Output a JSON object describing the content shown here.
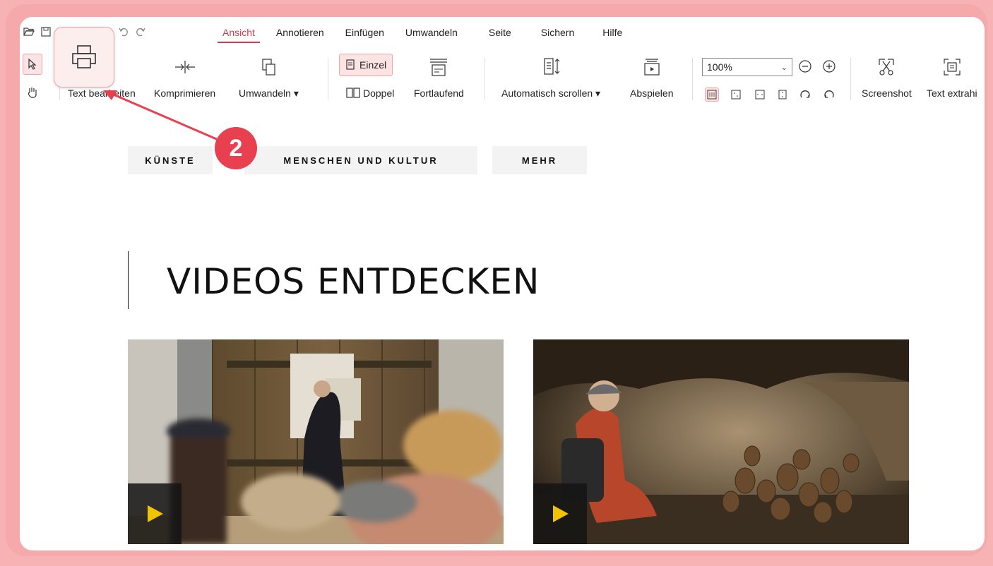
{
  "ribbon": {
    "tabs": [
      "Ansicht",
      "Annotieren",
      "Einfügen",
      "Umwandeln",
      "Seite",
      "Sichern",
      "Hilfe"
    ],
    "tools": {
      "edit_text": "Text bearbeiten",
      "compress": "Komprimieren",
      "convert": "Umwandeln ▾",
      "single": "Einzel",
      "double": "Doppel",
      "continuous": "Fortlaufend",
      "auto_scroll": "Automatisch scrollen ▾",
      "play": "Abspielen",
      "screenshot": "Screenshot",
      "extract_text": "Text extrahi"
    },
    "zoom": "100%"
  },
  "callout": {
    "step": "2"
  },
  "page": {
    "nav": [
      "KÜNSTE",
      "MENSCHEN UND KULTUR",
      "MEHR"
    ],
    "heading": "VIDEOS ENTDECKEN"
  },
  "colors": {
    "accent": "#d23b4a",
    "badge": "#e8404f",
    "frame": "#f6a9ab",
    "play": "#f2c400"
  }
}
